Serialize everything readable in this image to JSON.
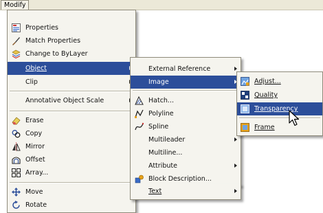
{
  "menubar": {
    "title": "Modify"
  },
  "modify_menu": {
    "items": [
      {
        "label": "Properties",
        "icon": "properties-icon"
      },
      {
        "label": "Match Properties",
        "icon": "match-properties-brush-icon"
      },
      {
        "label": "Change to ByLayer",
        "icon": "change-to-bylayer-icon"
      },
      {
        "label": "Object",
        "submenu": true,
        "highlighted": true
      },
      {
        "label": "Clip",
        "submenu": true
      },
      {
        "label": "Annotative Object Scale",
        "submenu": true
      },
      {
        "label": "Erase",
        "icon": "eraser-icon"
      },
      {
        "label": "Copy",
        "icon": "copy-icon"
      },
      {
        "label": "Mirror",
        "icon": "mirror-icon"
      },
      {
        "label": "Offset",
        "icon": "offset-icon"
      },
      {
        "label": "Array...",
        "icon": "array-icon"
      },
      {
        "label": "Move",
        "icon": "move-icon"
      },
      {
        "label": "Rotate",
        "icon": "rotate-icon"
      }
    ]
  },
  "object_menu": {
    "items": [
      {
        "label": "External Reference",
        "submenu": true
      },
      {
        "label": "Image",
        "submenu": true,
        "highlighted": true
      },
      {
        "label": "Hatch...",
        "icon": "hatch-icon"
      },
      {
        "label": "Polyline",
        "icon": "polyline-icon"
      },
      {
        "label": "Spline",
        "icon": "spline-icon"
      },
      {
        "label": "Multileader",
        "submenu": true
      },
      {
        "label": "Multiline..."
      },
      {
        "label": "Attribute",
        "submenu": true
      },
      {
        "label": "Block Description...",
        "icon": "block-description-icon"
      },
      {
        "label": "Text",
        "submenu": true
      }
    ]
  },
  "image_menu": {
    "items": [
      {
        "label": "Adjust...",
        "icon": "image-adjust-icon"
      },
      {
        "label": "Quality",
        "icon": "image-quality-icon"
      },
      {
        "label": "Transparency",
        "icon": "image-transparency-icon",
        "highlighted": true
      },
      {
        "label": "Frame",
        "icon": "image-frame-icon"
      }
    ]
  },
  "colors": {
    "highlight": "#2c4e9a",
    "menu_bg": "#f5f4ee",
    "menubar_bg": "#ece9d8"
  }
}
